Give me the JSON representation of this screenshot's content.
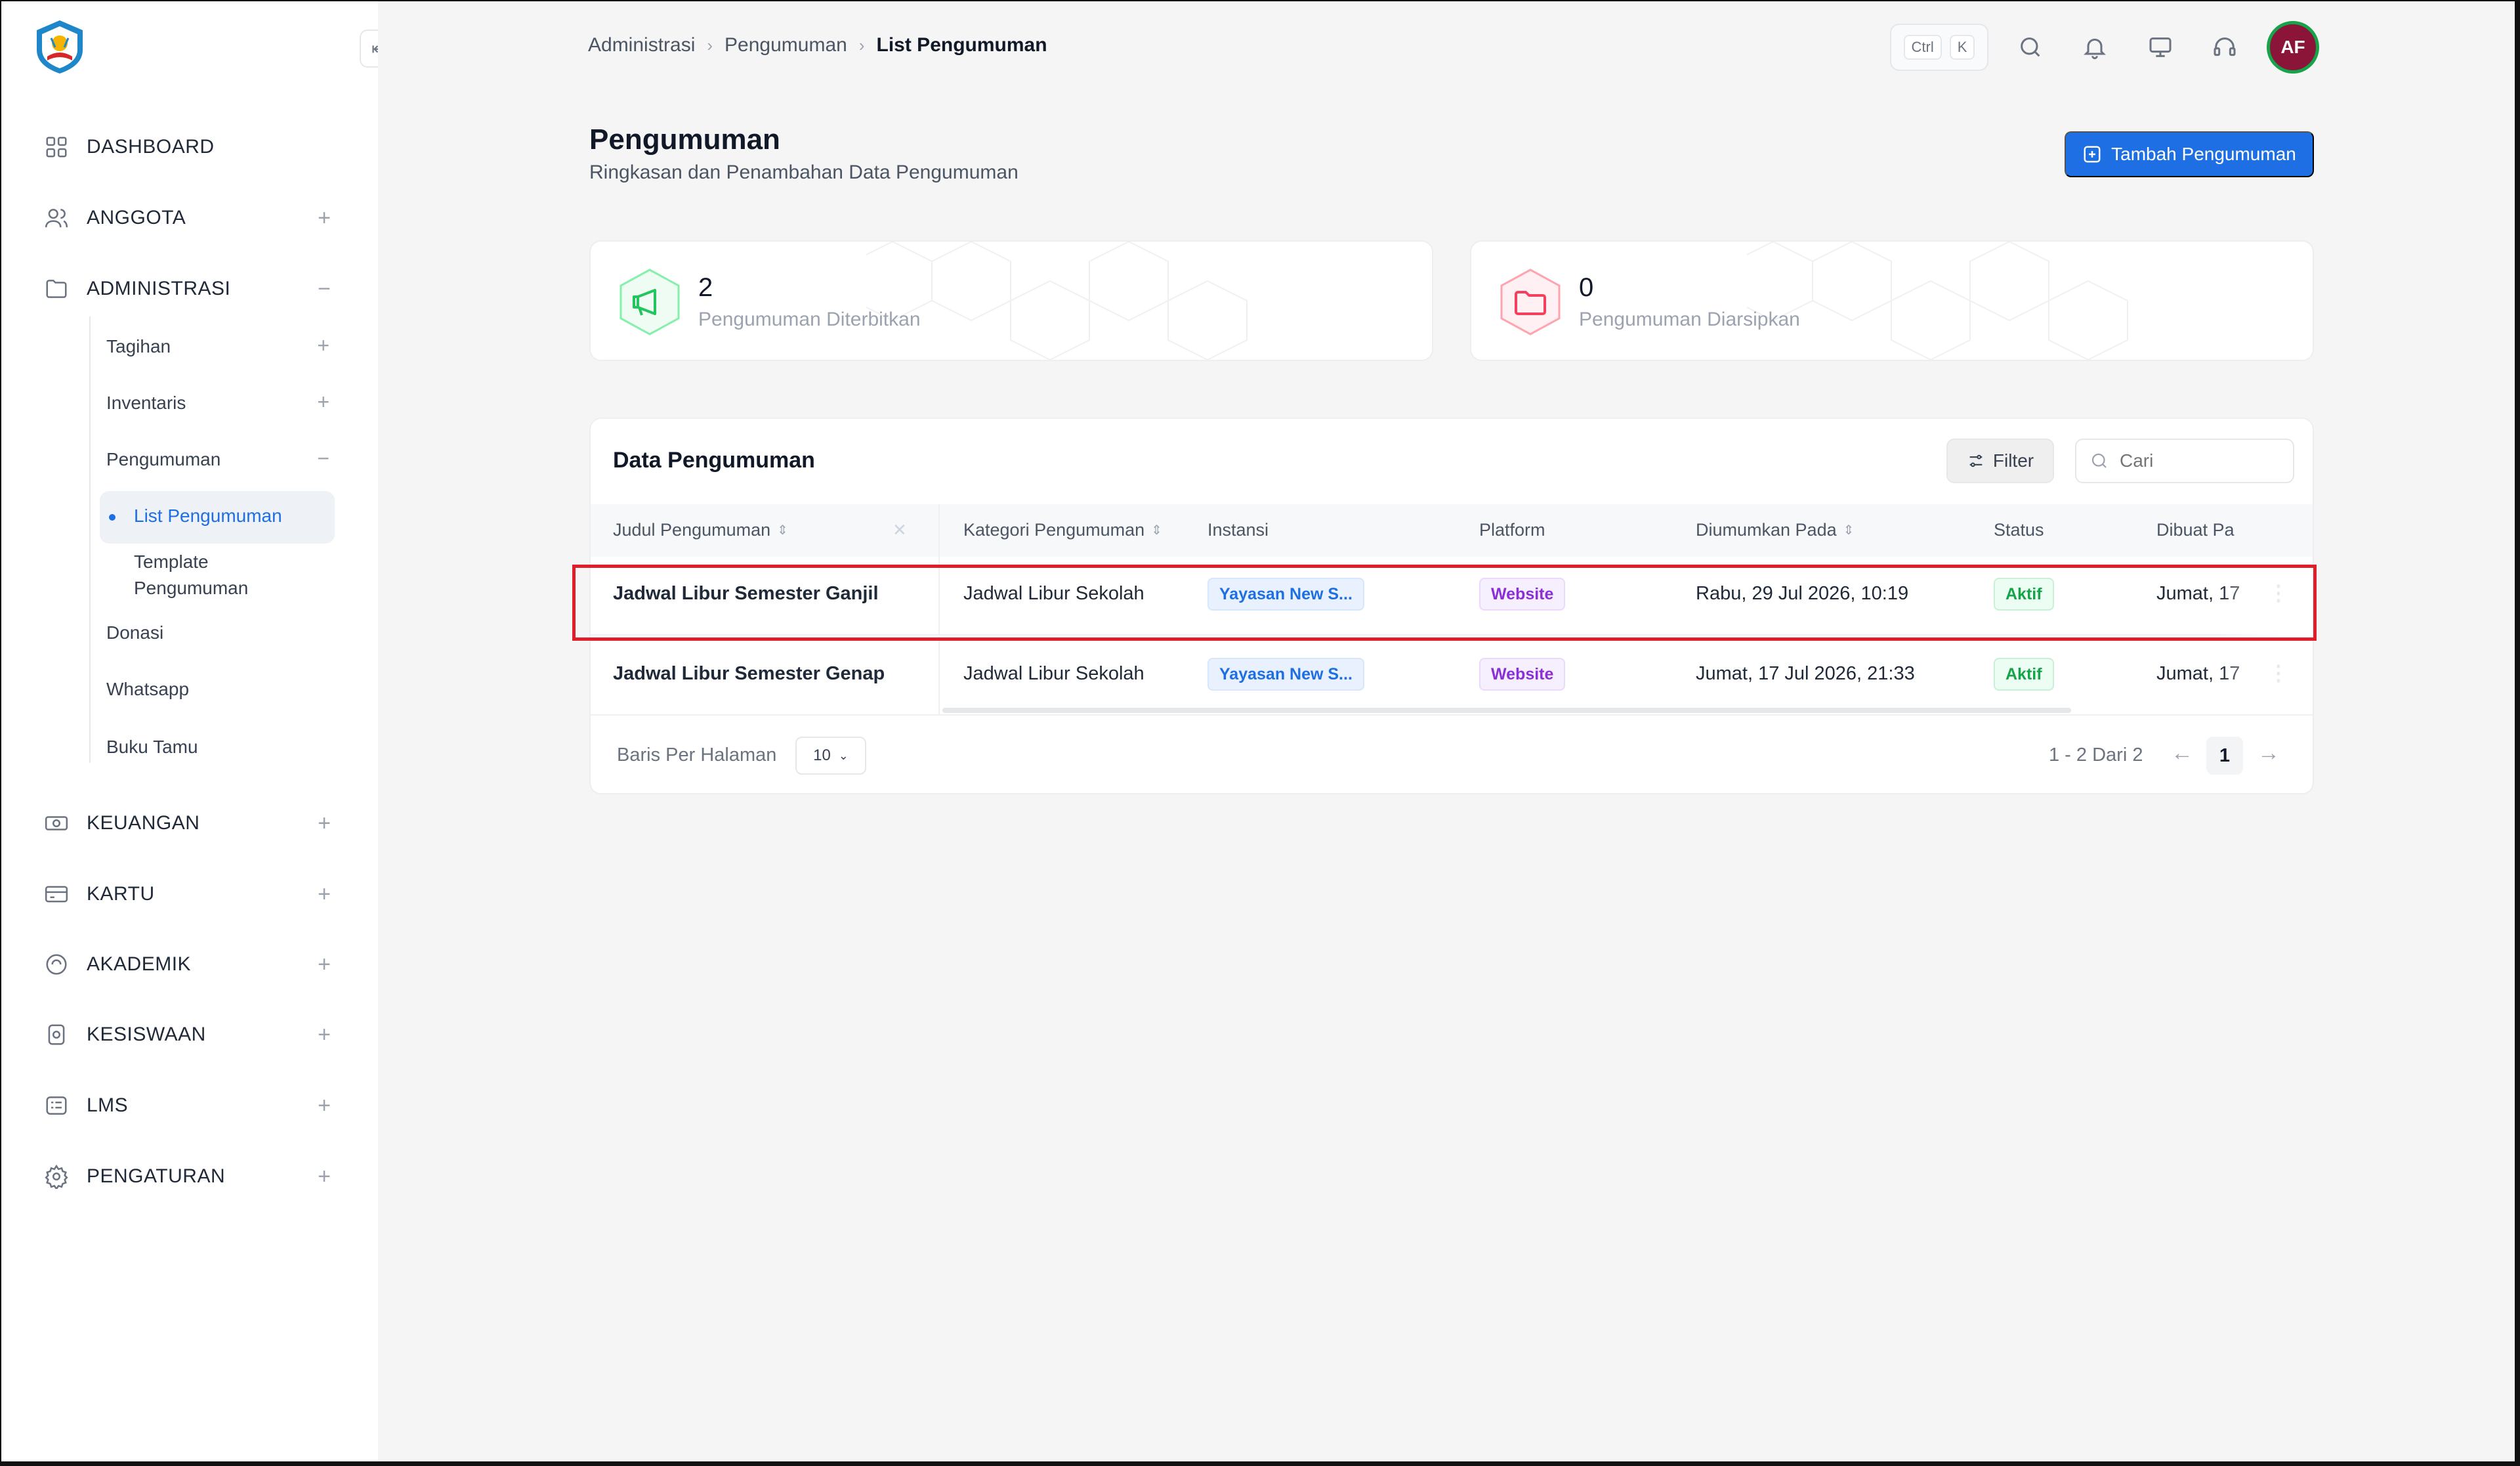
{
  "breadcrumb": {
    "items": [
      "Administrasi",
      "Pengumuman"
    ],
    "current": "List Pengumuman"
  },
  "topbar": {
    "shortcut_ctrl": "Ctrl",
    "shortcut_key": "K",
    "avatar_initials": "AF"
  },
  "sidebar": {
    "dashboard": "DASHBOARD",
    "anggota": "ANGGOTA",
    "administrasi": "ADMINISTRASI",
    "sub": {
      "tagihan": "Tagihan",
      "inventaris": "Inventaris",
      "pengumuman": "Pengumuman",
      "list_pengumuman": "List Pengumuman",
      "template_line1": "Template",
      "template_line2": "Pengumuman",
      "donasi": "Donasi",
      "whatsapp": "Whatsapp",
      "buku_tamu": "Buku Tamu"
    },
    "keuangan": "KEUANGAN",
    "kartu": "KARTU",
    "akademik": "AKADEMIK",
    "kesiswaan": "KESISWAAN",
    "lms": "LMS",
    "pengaturan": "PENGATURAN",
    "plus": "+",
    "minus": "−"
  },
  "header": {
    "title": "Pengumuman",
    "subtitle": "Ringkasan dan Penambahan Data Pengumuman",
    "add_button": "Tambah Pengumuman"
  },
  "stats": [
    {
      "value": "2",
      "label": "Pengumuman Diterbitkan",
      "color": "#22c55e"
    },
    {
      "value": "0",
      "label": "Pengumuman Diarsipkan",
      "color": "#f43f5e"
    }
  ],
  "table": {
    "title": "Data Pengumuman",
    "filter_label": "Filter",
    "search_placeholder": "Cari",
    "columns": [
      "Judul Pengumuman",
      "Kategori Pengumuman",
      "Instansi",
      "Platform",
      "Diumumkan Pada",
      "Status",
      "Dibuat Pa"
    ],
    "rows": [
      {
        "judul": "Jadwal Libur Semester Ganjil",
        "kategori": "Jadwal Libur Sekolah",
        "instansi": "Yayasan New S...",
        "platform": "Website",
        "diumumkan": "Rabu, 29 Jul 2026, 10:19",
        "status": "Aktif",
        "dibuat": "Jumat, 17"
      },
      {
        "judul": "Jadwal Libur Semester Genap",
        "kategori": "Jadwal Libur Sekolah",
        "instansi": "Yayasan New S...",
        "platform": "Website",
        "diumumkan": "Jumat, 17 Jul 2026, 21:33",
        "status": "Aktif",
        "dibuat": "Jumat, 17"
      }
    ],
    "rows_per_page_label": "Baris Per Halaman",
    "rows_per_page_value": "10",
    "pagination_info": "1 - 2 Dari 2",
    "current_page": "1"
  },
  "colors": {
    "accent": "#1d6fe3",
    "highlight": "#e11d2a",
    "avatar": "#8b1538"
  }
}
